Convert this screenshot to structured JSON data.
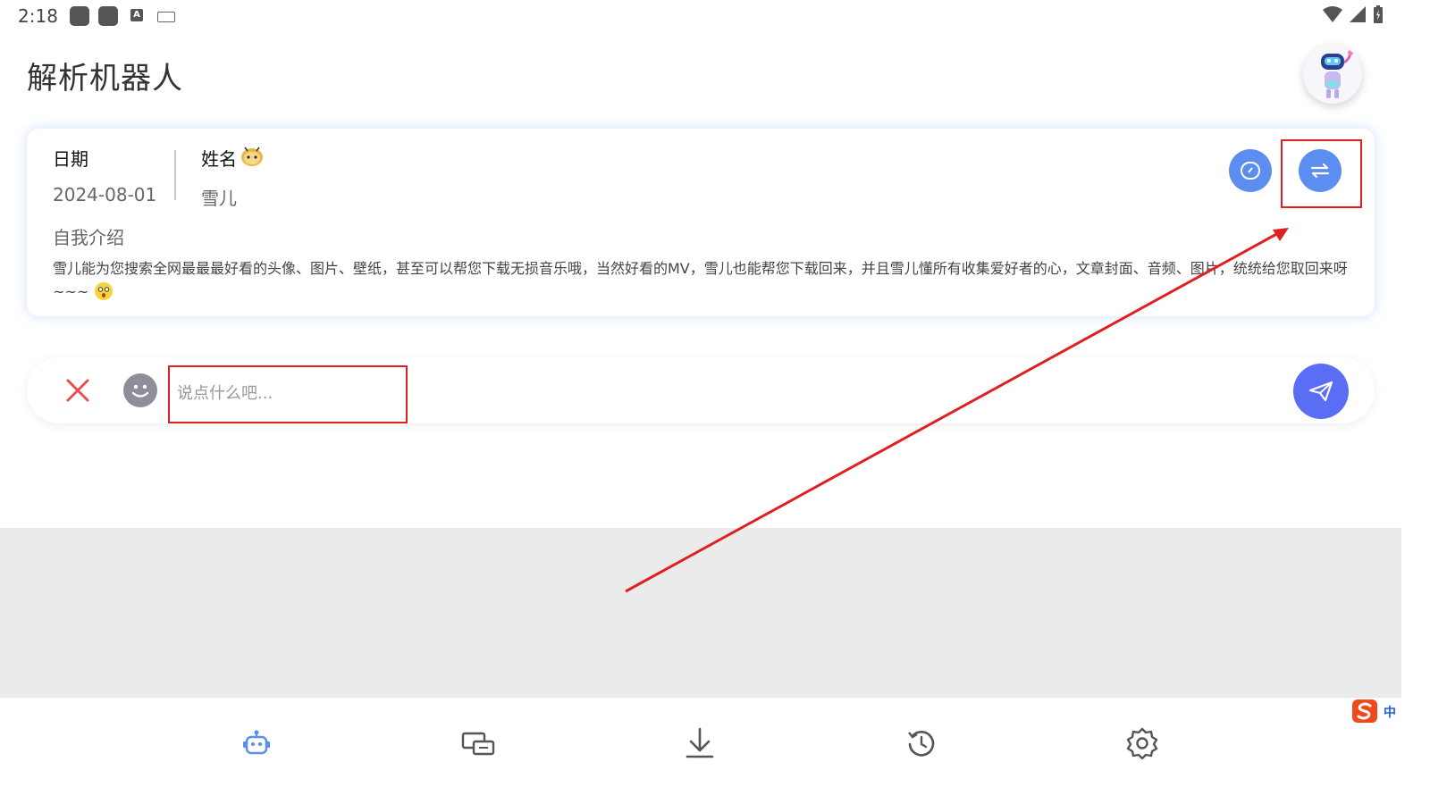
{
  "status_bar": {
    "time": "2:18",
    "input_method_letter": "A"
  },
  "header": {
    "title": "解析机器人"
  },
  "info_card": {
    "date_label": "日期",
    "date_value": "2024-08-01",
    "name_label": "姓名",
    "name_value": "雪儿",
    "intro_label": "自我介绍",
    "intro_text": "雪儿能为您搜索全网最最最好看的头像、图片、壁纸，甚至可以帮您下载无损音乐哦，当然好看的MV，雪儿也能帮您下载回来，并且雪儿懂所有收集爱好者的心，文章封面、音频、图片，统统给您取回来呀~~~"
  },
  "composer": {
    "placeholder": "说点什么吧..."
  },
  "ime": {
    "label": "中"
  },
  "colors": {
    "accent": "#5b8ef0",
    "send": "#5a6ef5",
    "annotation": "#e02020",
    "nav_active": "#5b8ef0",
    "nav_inactive": "#555555"
  },
  "icons": [
    "robot-icon",
    "toggle-icon",
    "swap-icon",
    "clear-icon",
    "emoji-icon",
    "send-icon",
    "devices-icon",
    "download-icon",
    "history-icon",
    "settings-icon"
  ]
}
